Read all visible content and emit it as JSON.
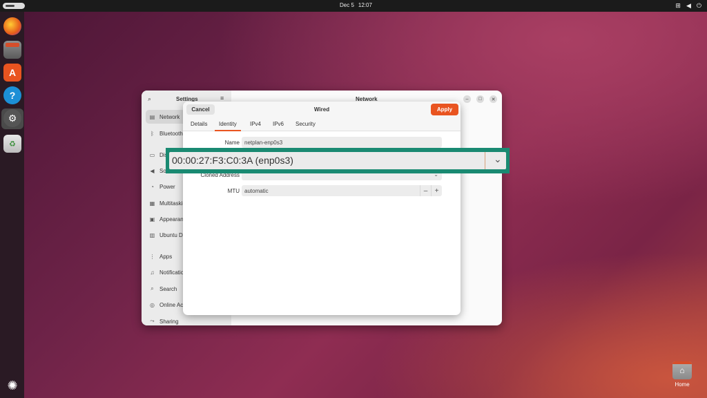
{
  "topbar": {
    "date": "Dec 5",
    "time": "12:07",
    "tray_icons": [
      "network-icon",
      "volume-icon",
      "power-icon"
    ]
  },
  "dock": {
    "items": [
      "firefox",
      "files",
      "app-center",
      "help",
      "settings",
      "trash",
      "show-apps"
    ]
  },
  "desktop": {
    "home_label": "Home"
  },
  "settings": {
    "title": "Settings",
    "page_header": "Network",
    "sidebar": [
      {
        "label": "Network",
        "icon": "network-icon"
      },
      {
        "label": "Bluetooth",
        "icon": "bluetooth-icon"
      },
      {
        "label": "Displays",
        "icon": "display-icon"
      },
      {
        "label": "Sound",
        "icon": "sound-icon"
      },
      {
        "label": "Power",
        "icon": "power-icon"
      },
      {
        "label": "Multitasking",
        "icon": "multitasking-icon"
      },
      {
        "label": "Appearance",
        "icon": "appearance-icon"
      },
      {
        "label": "Ubuntu Desktop",
        "icon": "ubuntu-desktop-icon"
      },
      {
        "label": "Apps",
        "icon": "apps-icon"
      },
      {
        "label": "Notifications",
        "icon": "notifications-icon"
      },
      {
        "label": "Search",
        "icon": "search-icon"
      },
      {
        "label": "Online Accounts",
        "icon": "online-accounts-icon"
      },
      {
        "label": "Sharing",
        "icon": "sharing-icon"
      }
    ]
  },
  "dialog": {
    "title": "Wired",
    "cancel_label": "Cancel",
    "apply_label": "Apply",
    "tabs": [
      "Details",
      "Identity",
      "IPv4",
      "IPv6",
      "Security"
    ],
    "active_tab": "Identity",
    "fields": {
      "name_label": "Name",
      "name_value": "netplan-enp0s3",
      "cloned_label": "Cloned Address",
      "cloned_value": "",
      "mtu_label": "MTU",
      "mtu_value": "automatic"
    }
  },
  "zoom": {
    "mac_value": "00:00:27:F3:C0:3A (enp0s3)"
  },
  "colors": {
    "accent": "#e95420",
    "zoom_frame": "#1a8a72"
  }
}
